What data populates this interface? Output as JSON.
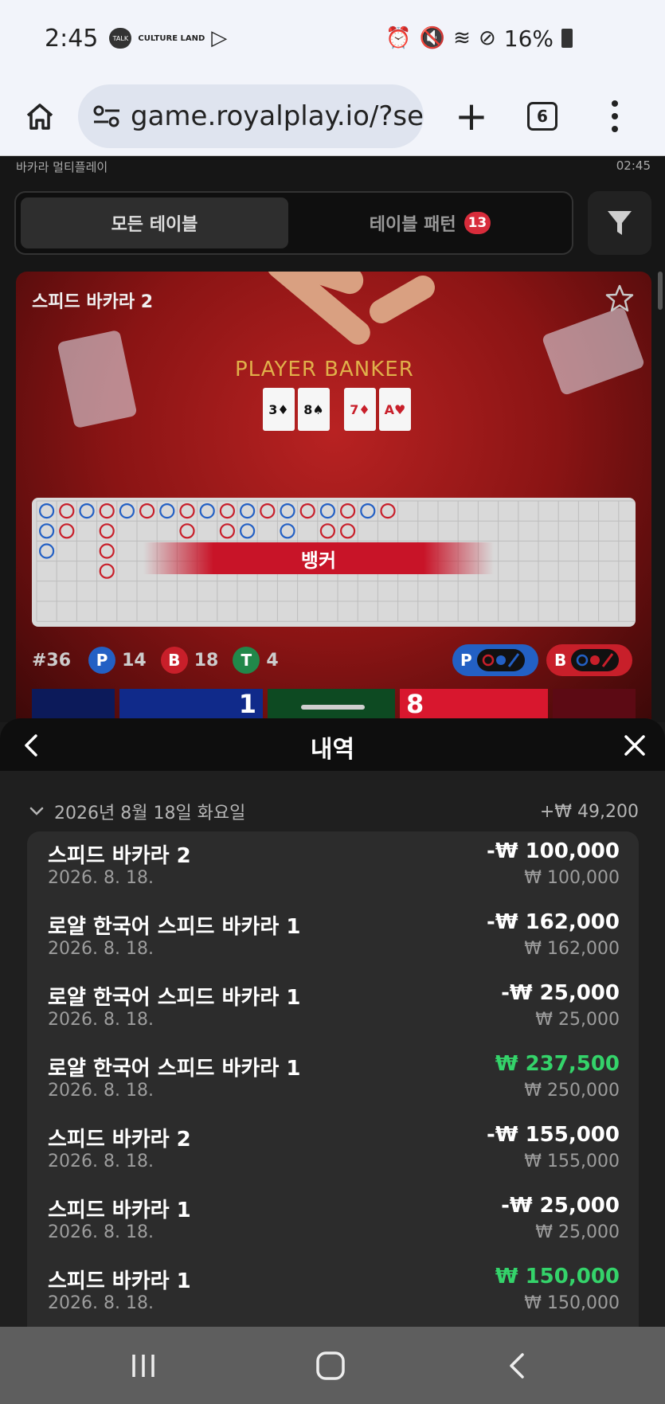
{
  "status_bar": {
    "time": "2:45",
    "talk_label": "TALK",
    "culture_label": "CULTURE LAND",
    "battery": "16%"
  },
  "browser": {
    "url": "game.royalplay.io/?ses",
    "tab_count": "6"
  },
  "game": {
    "header_title": "바카라 멀티플레이",
    "header_time": "02:45",
    "tabs": [
      {
        "label": "모든 테이블"
      },
      {
        "label": "테이블 패턴",
        "badge": "13"
      }
    ],
    "table_name": "스피드 바카라 2",
    "felt_text": "PLAYER  BANKER",
    "player_cards": [
      "3♦",
      "8♠"
    ],
    "banker_cards": [
      "7♦",
      "A♥"
    ],
    "banner": "뱅커",
    "round": "#36",
    "counts": {
      "p_label": "P",
      "p": "14",
      "b_label": "B",
      "b": "18",
      "t_label": "T",
      "t": "4"
    },
    "pill_p": "P",
    "pill_b": "B",
    "tile_values": [
      "1",
      "8"
    ]
  },
  "history": {
    "title": "내역",
    "day_label": "2026년 8월 18일 화요일",
    "day_total": "+₩ 49,200",
    "rows": [
      {
        "name": "스피드 바카라 2",
        "date": "2026. 8. 18.",
        "amount": "-₩ 100,000",
        "bet": "₩ 100,000",
        "win": false
      },
      {
        "name": "로얄 한국어 스피드 바카라 1",
        "date": "2026. 8. 18.",
        "amount": "-₩ 162,000",
        "bet": "₩ 162,000",
        "win": false
      },
      {
        "name": "로얄 한국어 스피드 바카라 1",
        "date": "2026. 8. 18.",
        "amount": "-₩ 25,000",
        "bet": "₩ 25,000",
        "win": false
      },
      {
        "name": "로얄 한국어 스피드 바카라 1",
        "date": "2026. 8. 18.",
        "amount": "₩ 237,500",
        "bet": "₩ 250,000",
        "win": true
      },
      {
        "name": "스피드 바카라 2",
        "date": "2026. 8. 18.",
        "amount": "-₩ 155,000",
        "bet": "₩ 155,000",
        "win": false
      },
      {
        "name": "스피드 바카라 1",
        "date": "2026. 8. 18.",
        "amount": "-₩ 25,000",
        "bet": "₩ 25,000",
        "win": false
      },
      {
        "name": "스피드 바카라 1",
        "date": "2026. 8. 18.",
        "amount": "₩ 150,000",
        "bet": "₩ 150,000",
        "win": true
      }
    ]
  },
  "colors": {
    "player_blue": "#2360c4",
    "banker_red": "#c81f2a",
    "tie_green": "#21884a",
    "win_green": "#34d36a"
  },
  "icons": [
    "home-icon",
    "tune-icon",
    "plus-icon",
    "tabs-icon",
    "more-vert-icon",
    "filter-icon",
    "star-icon",
    "chevron-left-icon",
    "close-icon",
    "chevron-down-icon",
    "recents-icon",
    "home-nav-icon",
    "back-nav-icon"
  ]
}
